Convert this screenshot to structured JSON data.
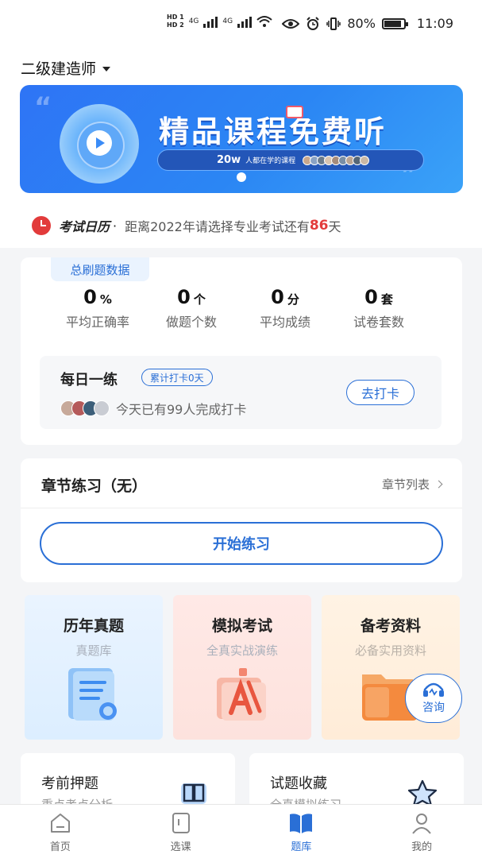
{
  "status_bar": {
    "hd1": "HD 1",
    "hd2": "HD 2",
    "net1": "4G",
    "net2": "4G",
    "battery_text": "80%",
    "battery_level": 0.8,
    "time": "11:09"
  },
  "header": {
    "exam_name": "二级建造师"
  },
  "banner": {
    "title": "精品课程免费听",
    "count": "20w",
    "caption": "人都在学的课程"
  },
  "calendar": {
    "label": "考试日历",
    "dot": "·",
    "text": "距离2022年请选择专业考试还有",
    "days": "86",
    "unit": "天"
  },
  "stats": {
    "tag": "总刷题数据",
    "items": [
      {
        "value": "0",
        "unit": "%",
        "label": "平均正确率"
      },
      {
        "value": "0",
        "unit": "个",
        "label": "做题个数"
      },
      {
        "value": "0",
        "unit": "分",
        "label": "平均成绩"
      },
      {
        "value": "0",
        "unit": "套",
        "label": "试卷套数"
      }
    ]
  },
  "daily": {
    "title": "每日一练",
    "badge": "累计打卡0天",
    "people_text": "今天已有99人完成打卡",
    "button": "去打卡"
  },
  "chapter": {
    "title": "章节练习（无）",
    "list_link": "章节列表",
    "start_button": "开始练习"
  },
  "tiles": [
    {
      "title": "历年真题",
      "subtitle": "真题库"
    },
    {
      "title": "模拟考试",
      "subtitle": "全真实战演练"
    },
    {
      "title": "备考资料",
      "subtitle": "必备实用资料"
    }
  ],
  "consult": {
    "label": "咨询"
  },
  "bottom_cards": [
    {
      "title": "考前押题",
      "subtitle": "重点考点分析"
    },
    {
      "title": "试题收藏",
      "subtitle": "全真模拟练习"
    }
  ],
  "tabbar": {
    "items": [
      {
        "label": "首页",
        "icon": "home-icon"
      },
      {
        "label": "选课",
        "icon": "course-icon"
      },
      {
        "label": "题库",
        "icon": "book-icon",
        "active": true
      },
      {
        "label": "我的",
        "icon": "profile-icon"
      }
    ]
  },
  "colors": {
    "accent": "#2a6fd6",
    "alert": "#e23b3b"
  }
}
